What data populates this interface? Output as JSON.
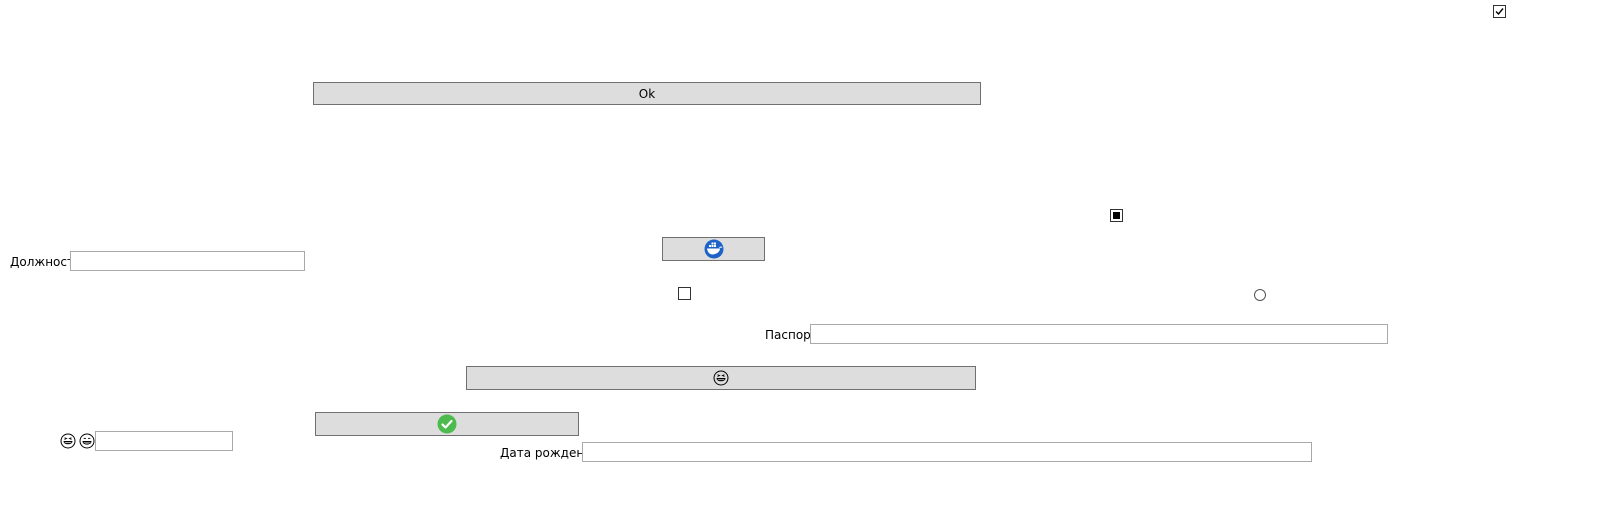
{
  "buttons": {
    "ok_label": "Ok",
    "docker_icon": "docker-whale-icon",
    "laugh_icon": "grinning-squint-tears-icon",
    "check_icon": "green-check-circle-icon"
  },
  "fields": {
    "position_label": "Должность",
    "position_value": "",
    "passport_label": "Паспорт",
    "passport_value": "",
    "birthdate_label": "Дата рождения",
    "birthdate_value": "",
    "emoji_field_value": ""
  },
  "controls": {
    "top_right_checkbox": "checked",
    "middle_checkbox": "indeterminate",
    "left_checkbox": "unchecked",
    "radio": "unselected"
  },
  "icons": {
    "emoji_1": "grinning-squint-tears-icon",
    "emoji_2": "grinning-face-icon"
  },
  "colors": {
    "button_bg": "#dddddd",
    "check_green": "#4cba4c",
    "docker_blue": "#1d63c7"
  }
}
